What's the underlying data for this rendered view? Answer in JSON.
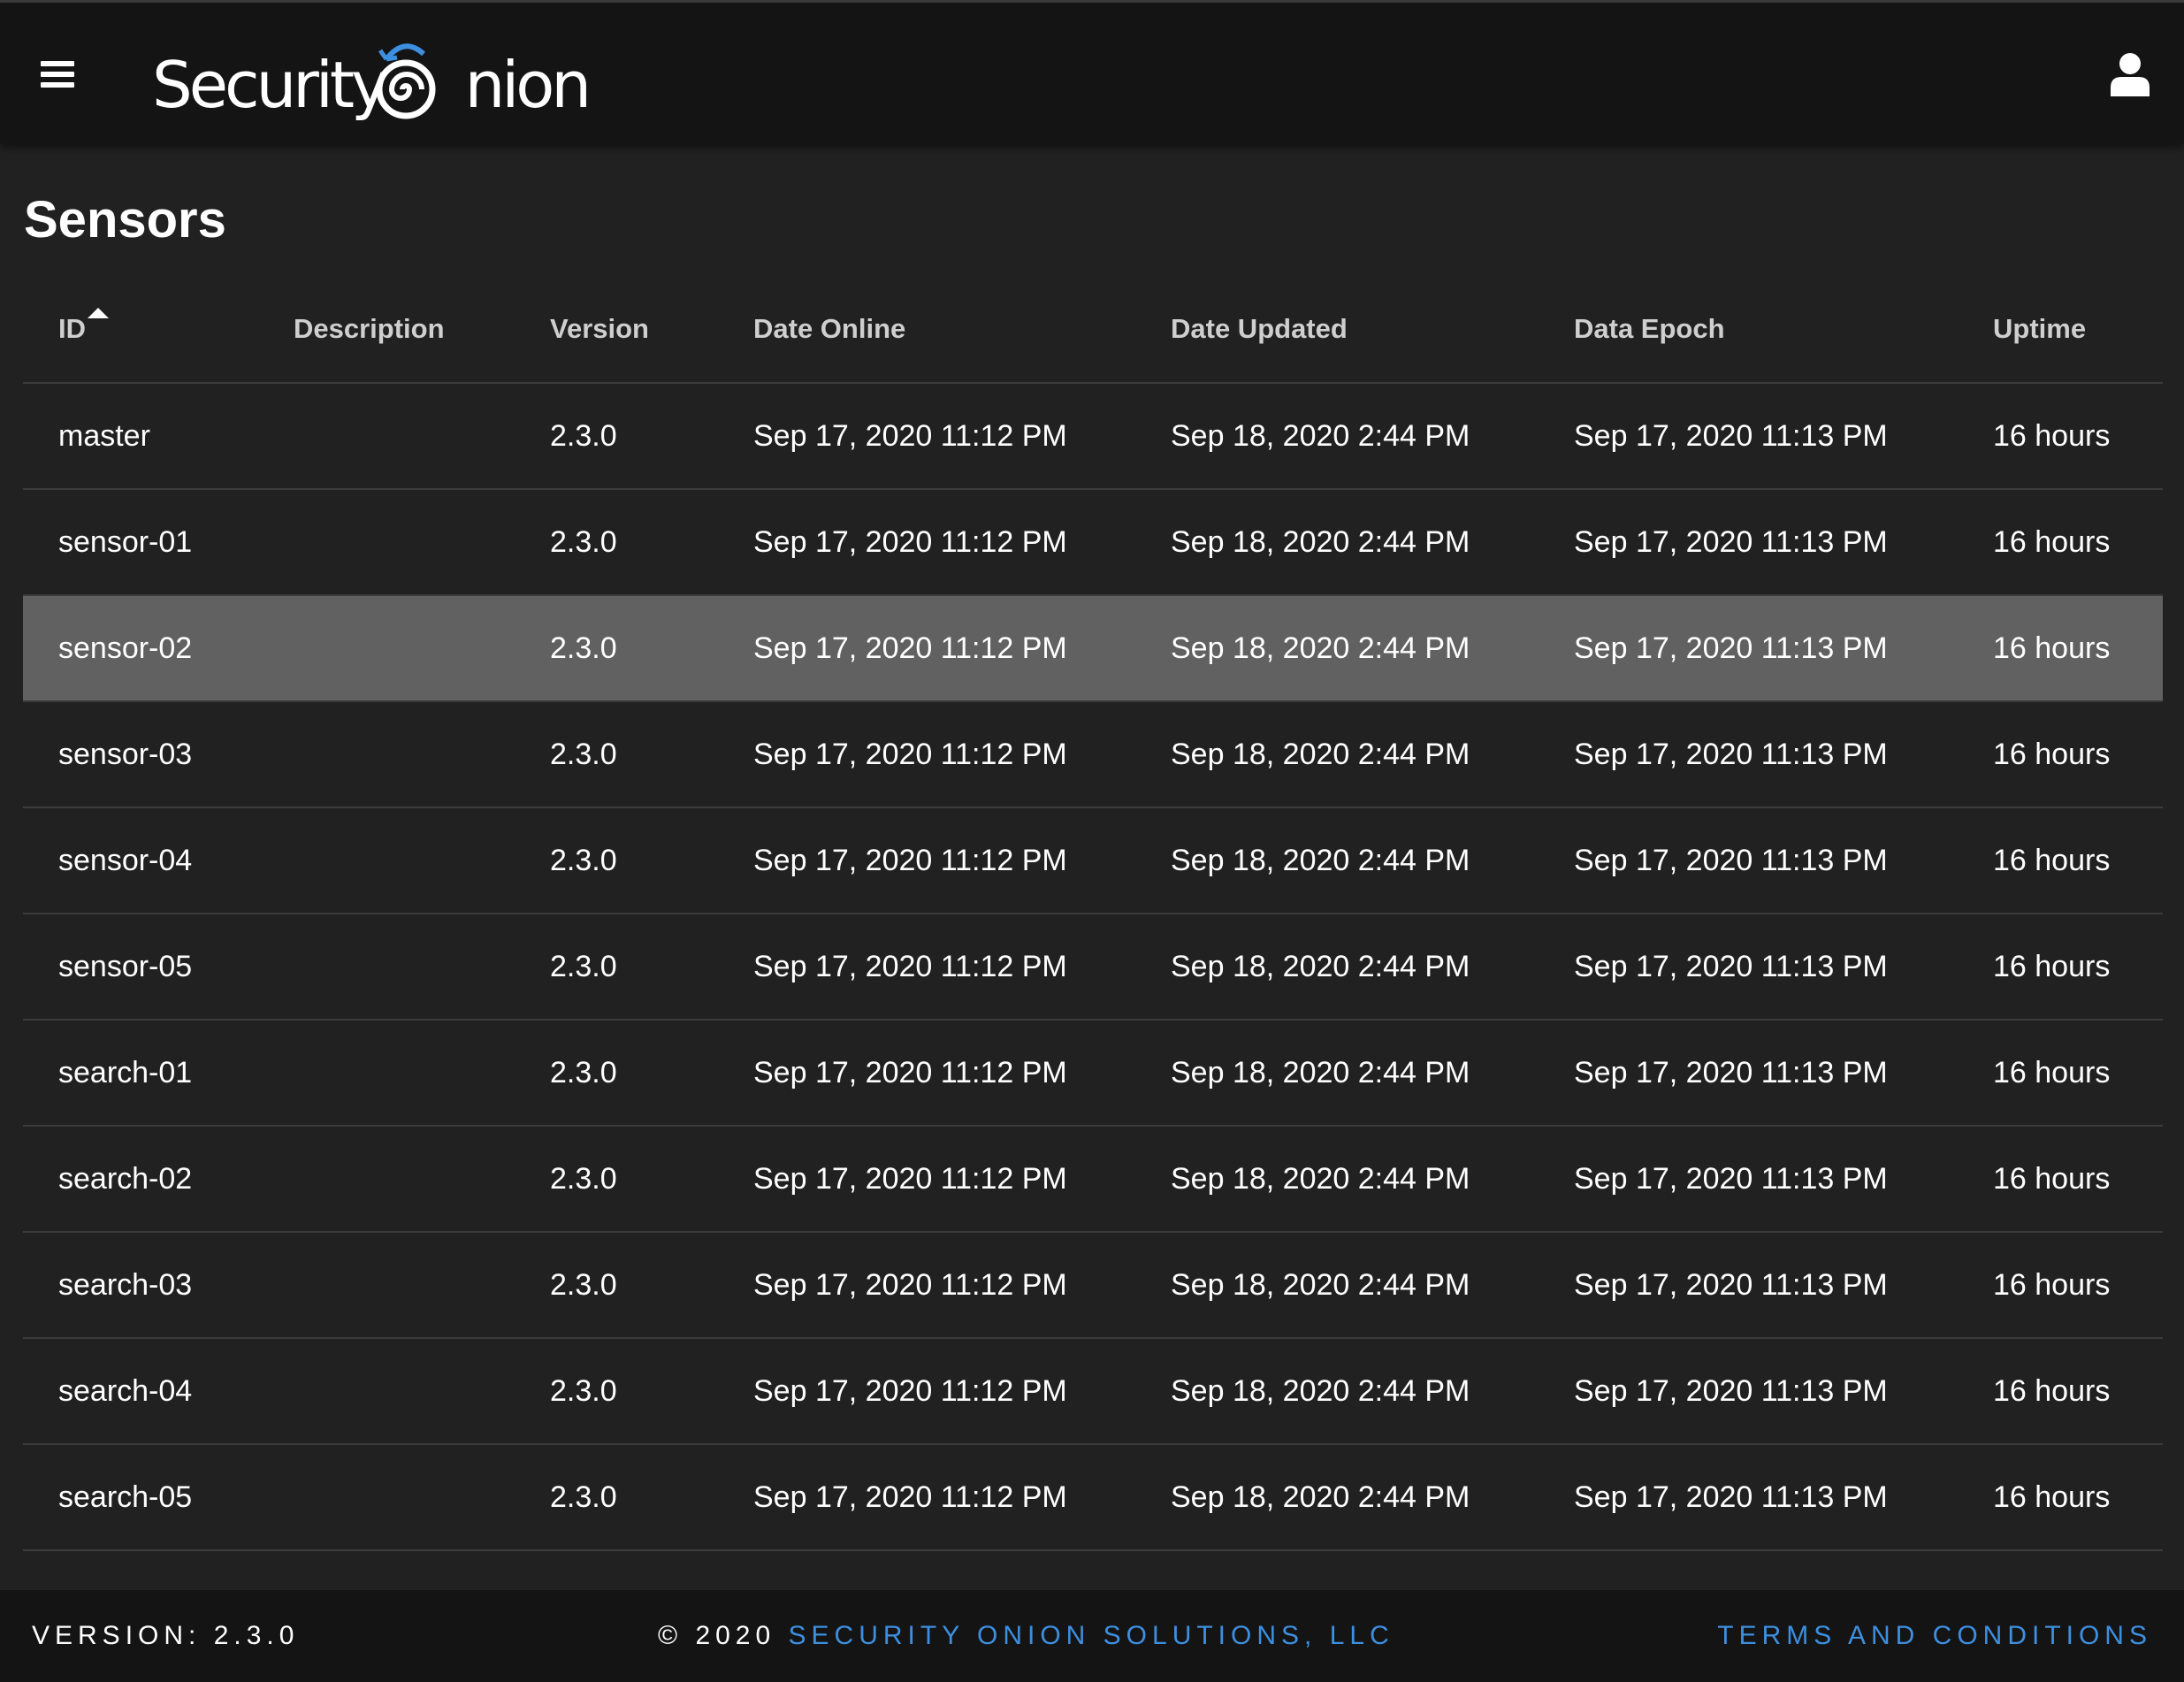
{
  "app": {
    "logo_text_left": "Security",
    "logo_text_right": "nion",
    "accent_color": "#3d8fe0"
  },
  "header": {
    "menu_icon": "hamburger-menu-icon",
    "user_icon": "user-icon"
  },
  "page": {
    "title": "Sensors"
  },
  "table": {
    "columns": [
      {
        "label": "ID",
        "sorted": "ascending"
      },
      {
        "label": "Description"
      },
      {
        "label": "Version"
      },
      {
        "label": "Date Online"
      },
      {
        "label": "Date Updated"
      },
      {
        "label": "Data Epoch"
      },
      {
        "label": "Uptime"
      }
    ],
    "selected_row": 2,
    "rows": [
      {
        "id": "master",
        "description": "",
        "version": "2.3.0",
        "date_online": "Sep 17, 2020 11:12 PM",
        "date_updated": "Sep 18, 2020 2:44 PM",
        "data_epoch": "Sep 17, 2020 11:13 PM",
        "uptime": "16 hours"
      },
      {
        "id": "sensor-01",
        "description": "",
        "version": "2.3.0",
        "date_online": "Sep 17, 2020 11:12 PM",
        "date_updated": "Sep 18, 2020 2:44 PM",
        "data_epoch": "Sep 17, 2020 11:13 PM",
        "uptime": "16 hours"
      },
      {
        "id": "sensor-02",
        "description": "",
        "version": "2.3.0",
        "date_online": "Sep 17, 2020 11:12 PM",
        "date_updated": "Sep 18, 2020 2:44 PM",
        "data_epoch": "Sep 17, 2020 11:13 PM",
        "uptime": "16 hours"
      },
      {
        "id": "sensor-03",
        "description": "",
        "version": "2.3.0",
        "date_online": "Sep 17, 2020 11:12 PM",
        "date_updated": "Sep 18, 2020 2:44 PM",
        "data_epoch": "Sep 17, 2020 11:13 PM",
        "uptime": "16 hours"
      },
      {
        "id": "sensor-04",
        "description": "",
        "version": "2.3.0",
        "date_online": "Sep 17, 2020 11:12 PM",
        "date_updated": "Sep 18, 2020 2:44 PM",
        "data_epoch": "Sep 17, 2020 11:13 PM",
        "uptime": "16 hours"
      },
      {
        "id": "sensor-05",
        "description": "",
        "version": "2.3.0",
        "date_online": "Sep 17, 2020 11:12 PM",
        "date_updated": "Sep 18, 2020 2:44 PM",
        "data_epoch": "Sep 17, 2020 11:13 PM",
        "uptime": "16 hours"
      },
      {
        "id": "search-01",
        "description": "",
        "version": "2.3.0",
        "date_online": "Sep 17, 2020 11:12 PM",
        "date_updated": "Sep 18, 2020 2:44 PM",
        "data_epoch": "Sep 17, 2020 11:13 PM",
        "uptime": "16 hours"
      },
      {
        "id": "search-02",
        "description": "",
        "version": "2.3.0",
        "date_online": "Sep 17, 2020 11:12 PM",
        "date_updated": "Sep 18, 2020 2:44 PM",
        "data_epoch": "Sep 17, 2020 11:13 PM",
        "uptime": "16 hours"
      },
      {
        "id": "search-03",
        "description": "",
        "version": "2.3.0",
        "date_online": "Sep 17, 2020 11:12 PM",
        "date_updated": "Sep 18, 2020 2:44 PM",
        "data_epoch": "Sep 17, 2020 11:13 PM",
        "uptime": "16 hours"
      },
      {
        "id": "search-04",
        "description": "",
        "version": "2.3.0",
        "date_online": "Sep 17, 2020 11:12 PM",
        "date_updated": "Sep 18, 2020 2:44 PM",
        "data_epoch": "Sep 17, 2020 11:13 PM",
        "uptime": "16 hours"
      },
      {
        "id": "search-05",
        "description": "",
        "version": "2.3.0",
        "date_online": "Sep 17, 2020 11:12 PM",
        "date_updated": "Sep 18, 2020 2:44 PM",
        "data_epoch": "Sep 17, 2020 11:13 PM",
        "uptime": "16 hours"
      }
    ]
  },
  "footer": {
    "version": "VERSION: 2.3.0",
    "copyright_prefix": "© 2020 ",
    "company_link": "SECURITY ONION SOLUTIONS, LLC",
    "terms_link": "TERMS AND CONDITIONS"
  }
}
